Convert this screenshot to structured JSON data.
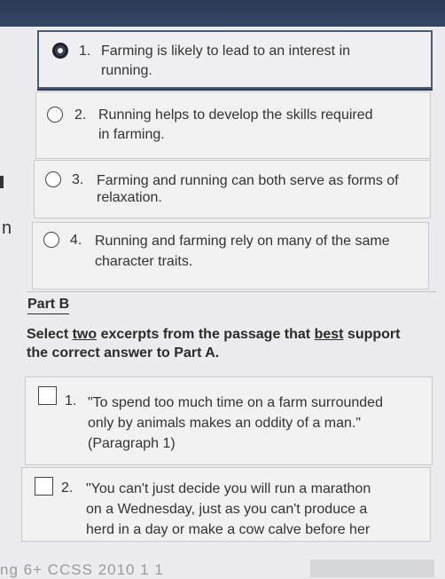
{
  "part_a": {
    "choices": [
      {
        "number": "1.",
        "text_line1": "Farming is likely to lead to an interest in",
        "text_line2": "running.",
        "selected": true
      },
      {
        "number": "2.",
        "text_line1": "Running helps to develop the skills required",
        "text_line2": "in farming.",
        "selected": false
      },
      {
        "number": "3.",
        "text_line1": "Farming and running can both serve as forms of",
        "text_line2": "relaxation.",
        "selected": false
      },
      {
        "number": "4.",
        "text_line1": "Running and farming rely on many of the same",
        "text_line2": "character traits.",
        "selected": false
      }
    ]
  },
  "left_margin_letter": "n",
  "part_b": {
    "label": "Part B",
    "instruction_pre": "Select ",
    "instruction_two": "two",
    "instruction_mid": " excerpts from the passage that ",
    "instruction_best": "best",
    "instruction_post": " support the correct answer to Part A.",
    "excerpts": [
      {
        "number": "1.",
        "line1": "\"To spend too much time on a farm surrounded",
        "line2": "only by animals makes an oddity of a man.\"",
        "line3": "(Paragraph 1)"
      },
      {
        "number": "2.",
        "line1": "\"You can't just decide you will run a marathon",
        "line2": "on a Wednesday, just as you can't produce a",
        "line3": "herd in a day or make a cow calve before her"
      }
    ]
  },
  "footer_text": "ng 6+ CCSS 2010 1 1"
}
